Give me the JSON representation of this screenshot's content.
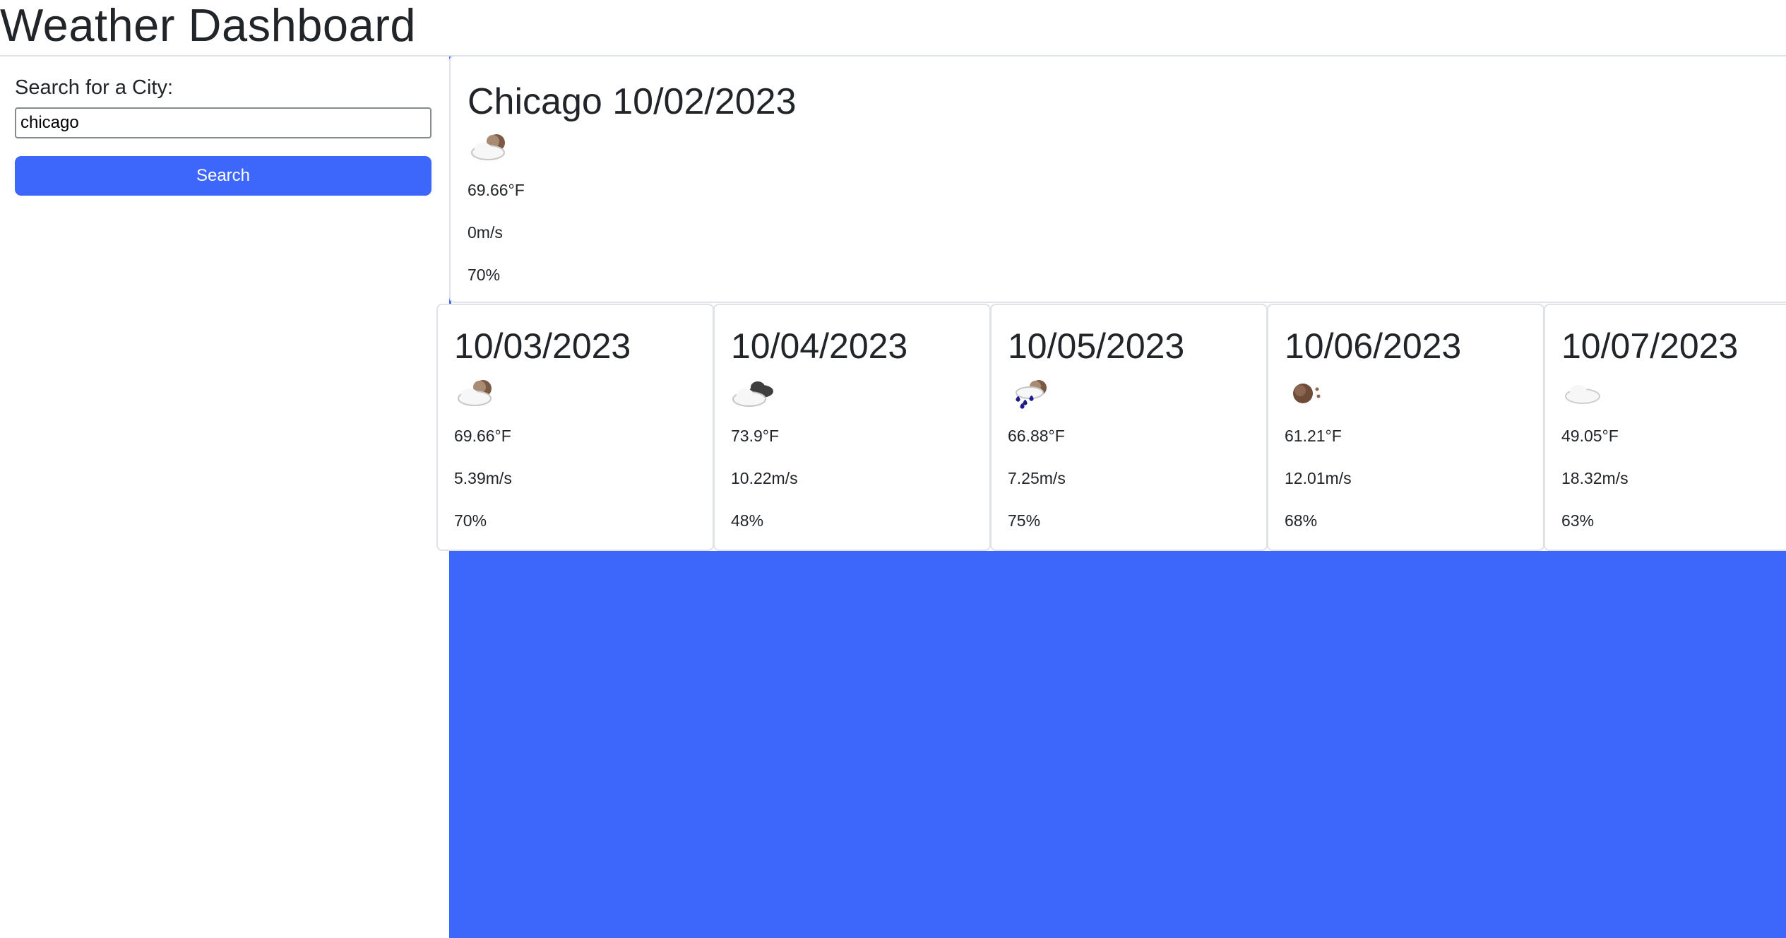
{
  "page": {
    "title": "Weather Dashboard"
  },
  "search": {
    "label": "Search for a City:",
    "value": "chicago",
    "placeholder": "",
    "button_label": "Search"
  },
  "current": {
    "city_date": "Chicago 10/02/2023",
    "icon": "partly-cloudy-night-icon",
    "temp": "69.66°F",
    "wind": "0m/s",
    "humidity": "70%"
  },
  "forecast": [
    {
      "date": "10/03/2023",
      "icon": "partly-cloudy-night-icon",
      "temp": "69.66°F",
      "wind": "5.39m/s",
      "humidity": "70%"
    },
    {
      "date": "10/04/2023",
      "icon": "broken-clouds-icon",
      "temp": "73.9°F",
      "wind": "10.22m/s",
      "humidity": "48%"
    },
    {
      "date": "10/05/2023",
      "icon": "rain-night-icon",
      "temp": "66.88°F",
      "wind": "7.25m/s",
      "humidity": "75%"
    },
    {
      "date": "10/06/2023",
      "icon": "clear-night-icon",
      "temp": "61.21°F",
      "wind": "12.01m/s",
      "humidity": "68%"
    },
    {
      "date": "10/07/2023",
      "icon": "scattered-clouds-icon",
      "temp": "49.05°F",
      "wind": "18.32m/s",
      "humidity": "63%"
    }
  ],
  "colors": {
    "accent": "#3d66fb",
    "text": "#212529",
    "card_border": "#dfe2e6",
    "moon": "#7a5a45",
    "rain": "#1f1a8c"
  }
}
